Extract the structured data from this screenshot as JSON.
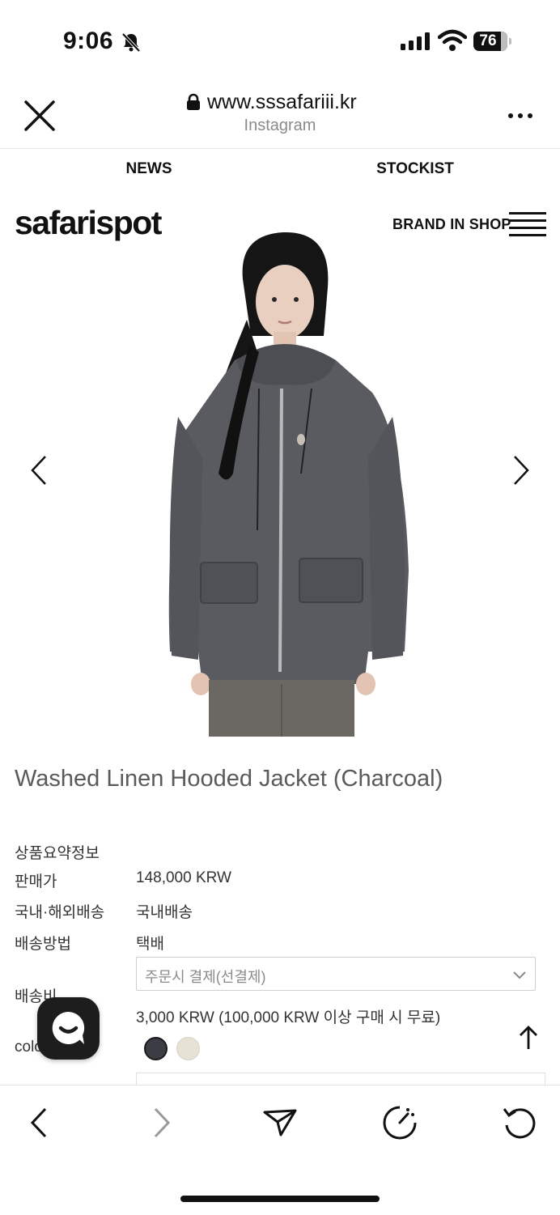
{
  "status_bar": {
    "time": "9:06",
    "battery": "76"
  },
  "browser": {
    "url": "www.sssafariii.kr",
    "source": "Instagram"
  },
  "nav": {
    "news": "NEWS",
    "stockist": "STOCKIST"
  },
  "site": {
    "logo": "safarispot",
    "brand_in_shop": "BRAND IN SHOP"
  },
  "product": {
    "title": "Washed Linen Hooded Jacket (Charcoal)",
    "summary_label": "상품요약정보",
    "price_label": "판매가",
    "price_value": "148,000 KRW",
    "shipping_region_label": "국내·해외배송",
    "shipping_region_value": "국내배송",
    "shipping_method_label": "배송방법",
    "shipping_method_value": "택배",
    "shipping_fee_label": "배송비",
    "shipping_fee_select": "주문시 결제(선결제)",
    "shipping_fee_value": "3,000 KRW (100,000 KRW 이상 구매 시 무료)",
    "color_label": "color",
    "swatches": [
      {
        "name": "charcoal",
        "color": "#3b3d45"
      },
      {
        "name": "ivory",
        "color": "#e6e2d6"
      }
    ]
  },
  "icons": {
    "close": "close-icon",
    "lock": "lock-icon",
    "more": "more-icon",
    "menu": "hamburger-menu-icon",
    "prev": "chevron-left-icon",
    "next": "chevron-right-icon",
    "chat": "chat-icon",
    "scroll_top": "arrow-up-icon",
    "back": "back-icon",
    "forward": "forward-icon",
    "share": "share-icon",
    "speed": "speedometer-icon",
    "reload": "reload-icon"
  }
}
